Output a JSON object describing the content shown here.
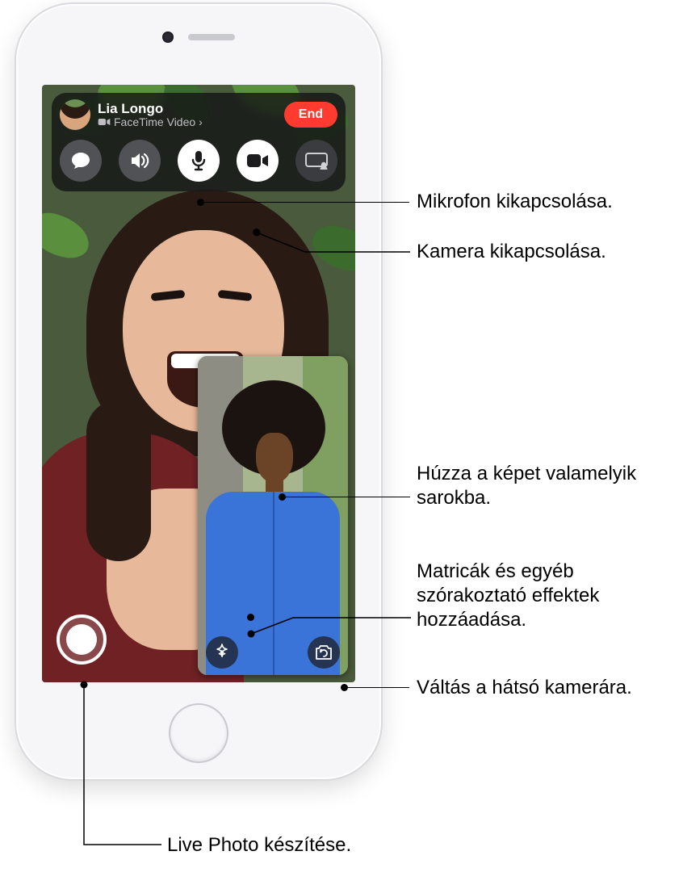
{
  "call": {
    "name": "Lia Longo",
    "subtitle": "FaceTime Video",
    "end_label": "End"
  },
  "controls": {
    "messages_icon": "message-icon",
    "speaker_icon": "speaker-icon",
    "mic_icon": "mic-icon",
    "camera_icon": "video-icon",
    "shareplay_icon": "shareplay-icon"
  },
  "callouts": {
    "mute_mic": "Mikrofon kikapcsolása.",
    "mute_camera": "Kamera kikapcsolása.",
    "drag_pip": "Húzza a képet valamelyik sarokba.",
    "effects": "Matricák és egyéb szórakoztató effektek hozzáadása.",
    "flip_camera": "Váltás a hátsó kamerára.",
    "live_photo": "Live Photo készítése."
  }
}
